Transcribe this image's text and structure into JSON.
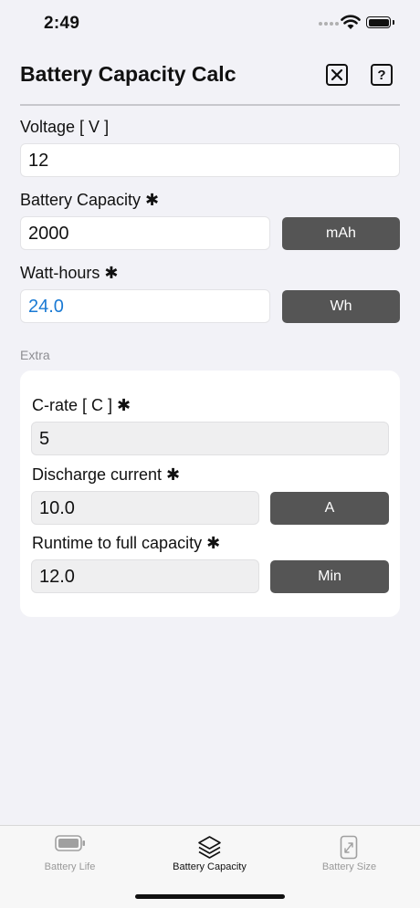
{
  "status": {
    "time": "2:49"
  },
  "header": {
    "title": "Battery Capacity Calc",
    "help_label": "?"
  },
  "fields": {
    "voltage": {
      "label": "Voltage [ V ]",
      "value": "12"
    },
    "capacity": {
      "label": "Battery Capacity ✱",
      "value": "2000",
      "unit": "mAh"
    },
    "watt_hours": {
      "label": "Watt-hours ✱",
      "value": "24.0",
      "unit": "Wh"
    }
  },
  "extra": {
    "title": "Extra",
    "c_rate": {
      "label": "C-rate [ C ] ✱",
      "value": "5"
    },
    "discharge": {
      "label": "Discharge current ✱",
      "value": "10.0",
      "unit": "A"
    },
    "runtime": {
      "label": "Runtime to full capacity ✱",
      "value": "12.0",
      "unit": "Min"
    }
  },
  "tabs": [
    {
      "label": "Battery Life",
      "icon": "battery-icon"
    },
    {
      "label": "Battery Capacity",
      "icon": "layers-icon",
      "active": true
    },
    {
      "label": "Battery Size",
      "icon": "resize-icon"
    }
  ],
  "colors": {
    "accent_value": "#1a7ad4",
    "unit_button": "#555555"
  }
}
